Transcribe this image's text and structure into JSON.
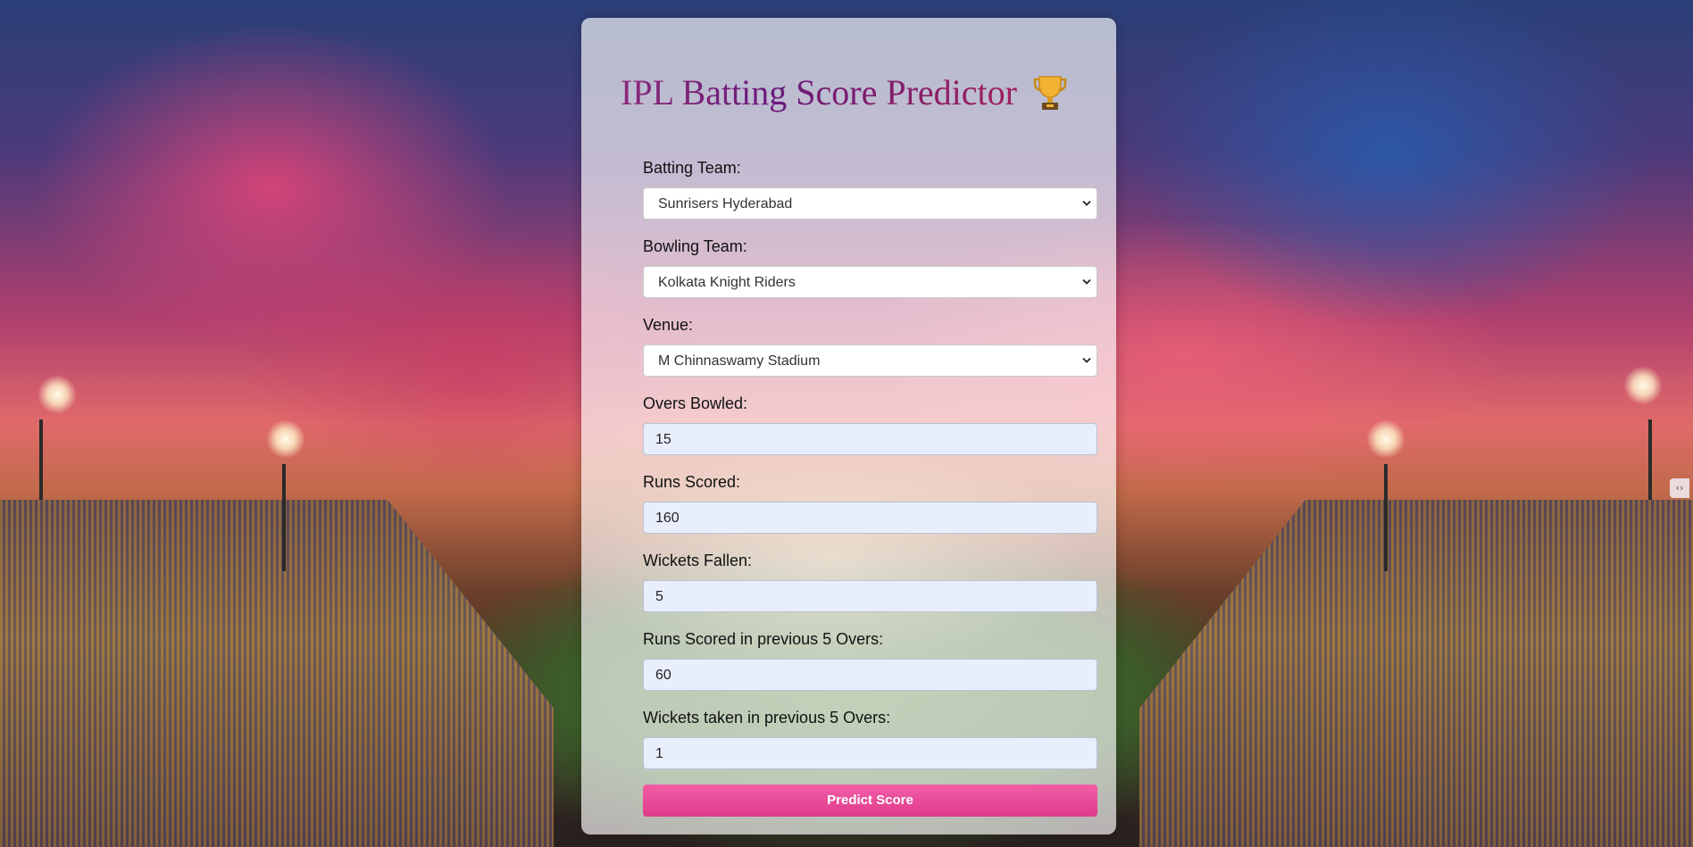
{
  "page": {
    "title": "IPL Batting Score Predictor",
    "trophy_icon": "trophy-icon"
  },
  "form": {
    "batting_team": {
      "label": "Batting Team:",
      "value": "Sunrisers Hyderabad"
    },
    "bowling_team": {
      "label": "Bowling Team:",
      "value": "Kolkata Knight Riders"
    },
    "venue": {
      "label": "Venue:",
      "value": "M Chinnaswamy Stadium"
    },
    "overs_bowled": {
      "label": "Overs Bowled:",
      "value": "15"
    },
    "runs_scored": {
      "label": "Runs Scored:",
      "value": "160"
    },
    "wickets_fallen": {
      "label": "Wickets Fallen:",
      "value": "5"
    },
    "runs_last_5": {
      "label": "Runs Scored in previous 5 Overs:",
      "value": "60"
    },
    "wickets_last_5": {
      "label": "Wickets taken in previous 5 Overs:",
      "value": "1"
    },
    "submit_label": "Predict Score"
  },
  "colors": {
    "button": "#e8458f",
    "title_gradient_start": "#8a2a7a",
    "title_gradient_end": "#a0205a",
    "input_bg": "#e8eefc"
  }
}
